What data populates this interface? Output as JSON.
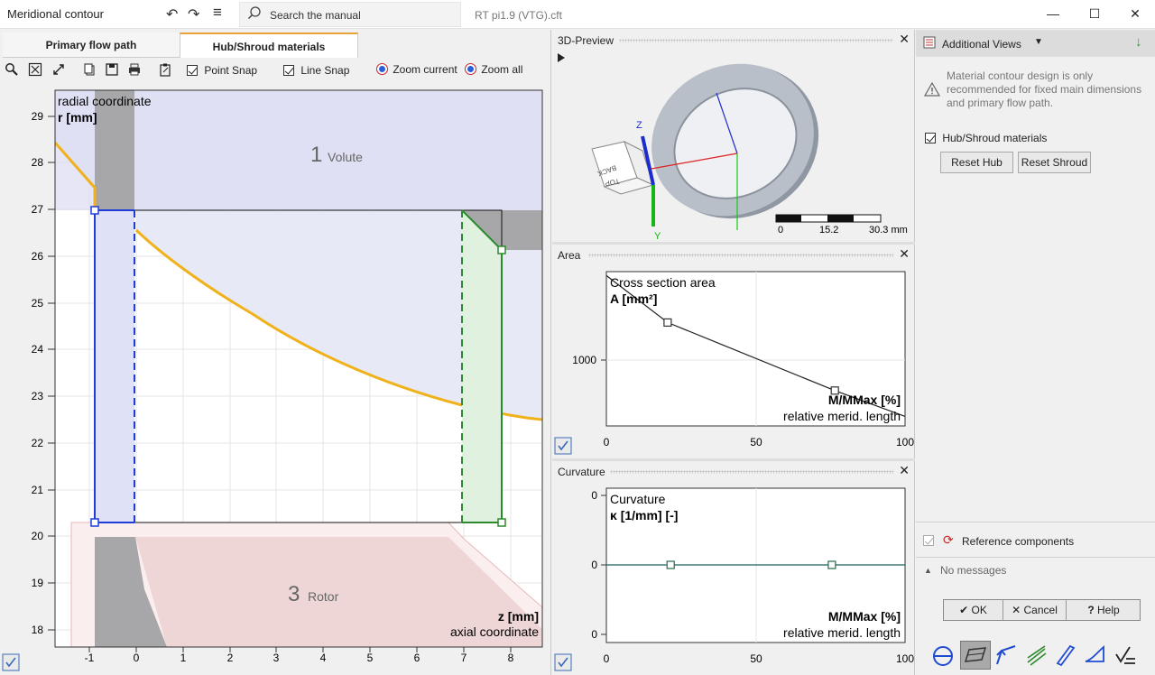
{
  "window": {
    "title": "Meridional contour",
    "search_placeholder": "Search the manual",
    "filename": "RT pi1.9 (VTG).cft",
    "controls": {
      "minimize": "—",
      "maximize": "☐",
      "close": "✕"
    },
    "icons": [
      "undo-icon",
      "redo-icon",
      "menu-icon",
      "search-icon"
    ]
  },
  "left": {
    "tabs": [
      "Primary flow path",
      "Hub/Shroud materials"
    ],
    "active_tab": "Hub/Shroud materials",
    "toolbar": {
      "point_snap": "Point Snap",
      "point_snap_checked": true,
      "line_snap": "Line Snap",
      "line_snap_checked": true,
      "zoom_current": "Zoom current",
      "zoom_all": "Zoom all"
    },
    "chart": {
      "ylabel_top": "radial coordinate",
      "ylabel_unit": "r [mm]",
      "xlabel_unit": "z [mm]",
      "xlabel_bottom": "axial coordinate",
      "region1_num": "1",
      "region1_name": "Volute",
      "region3_num": "3",
      "region3_name": "Rotor",
      "yticks": [
        "29",
        "28",
        "27",
        "26",
        "25",
        "24",
        "23",
        "22",
        "21",
        "20",
        "19",
        "18"
      ],
      "xticks": [
        "-1",
        "0",
        "1",
        "2",
        "3",
        "4",
        "5",
        "6",
        "7",
        "8"
      ]
    }
  },
  "preview": {
    "title": "3D-Preview",
    "scale_labels": [
      "0",
      "15.2",
      "30.3 mm"
    ],
    "cube_labels": [
      "BACK",
      "TOP"
    ],
    "axis_labels": [
      "Z",
      "Y"
    ]
  },
  "area": {
    "title": "Area",
    "ylabel_top": "Cross section area",
    "ylabel_unit": "A [mm²]",
    "xlabel_unit": "M/MMax [%]",
    "xlabel_bottom": "relative merid. length",
    "ytick": "1000",
    "xticks": [
      "0",
      "50",
      "100"
    ]
  },
  "curvature": {
    "title": "Curvature",
    "ylabel_top": "Curvature",
    "ylabel_unit": "κ [1/mm] [-]",
    "xlabel_unit": "M/MMax [%]",
    "xlabel_bottom": "relative merid. length",
    "yticks": [
      "0",
      "0",
      "0"
    ],
    "xticks": [
      "0",
      "50",
      "100"
    ]
  },
  "right": {
    "additional_views": "Additional Views",
    "warning": "Material contour design is only recommended for fixed main dimensions and primary flow path.",
    "hub_shroud": "Hub/Shroud materials",
    "hub_shroud_checked": true,
    "reset_hub": "Reset Hub",
    "reset_shroud": "Reset Shroud",
    "reference_components": "Reference components",
    "messages": "No messages",
    "ok": "OK",
    "cancel": "Cancel",
    "help": "Help"
  },
  "chart_data": [
    {
      "type": "line",
      "title": "Cross section area",
      "xlabel": "M/MMax [%]",
      "ylabel": "A [mm²]",
      "x": [
        0,
        20.5,
        76.5,
        100
      ],
      "y": [
        1180,
        1080,
        935,
        880
      ],
      "xlim": [
        0,
        100
      ],
      "markers_at": [
        20.5,
        76.5
      ]
    },
    {
      "type": "line",
      "title": "Curvature",
      "xlabel": "M/MMax [%]",
      "ylabel": "κ [1/mm] [-]",
      "x": [
        0,
        21.5,
        75.5,
        100
      ],
      "y": [
        0,
        0,
        0,
        0
      ],
      "xlim": [
        0,
        100
      ],
      "markers_at": [
        21.5,
        75.5
      ]
    }
  ]
}
